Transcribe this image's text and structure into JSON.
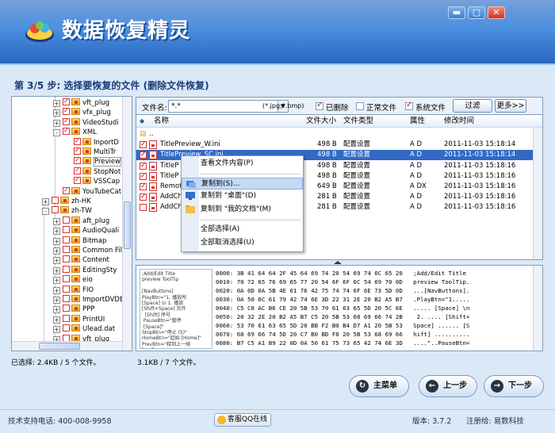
{
  "app": {
    "title": "数据恢复精灵"
  },
  "window_controls": {
    "minimize": "▬",
    "maximize": "▢",
    "close": "✕"
  },
  "step": {
    "title": "第 3/5 步: 选择要恢复的文件 (删除文件恢复)"
  },
  "tree": {
    "items": [
      {
        "label": "vft_plug",
        "level": 3,
        "checked": true,
        "exp": "+"
      },
      {
        "label": "vfx_plug",
        "level": 3,
        "checked": true,
        "exp": "+"
      },
      {
        "label": "VideoStudi",
        "level": 3,
        "checked": true,
        "exp": "+"
      },
      {
        "label": "XML",
        "level": 3,
        "checked": true,
        "exp": "-"
      },
      {
        "label": "InportD",
        "level": 4,
        "checked": true,
        "exp": ""
      },
      {
        "label": "MultiTr",
        "level": 4,
        "checked": true,
        "exp": ""
      },
      {
        "label": "Preview",
        "level": 4,
        "checked": true,
        "exp": ""
      },
      {
        "label": "StopNot",
        "level": 4,
        "checked": true,
        "exp": ""
      },
      {
        "label": "VSSCap",
        "level": 4,
        "checked": true,
        "exp": ""
      },
      {
        "label": "YouTubeCat",
        "level": 3,
        "checked": true,
        "exp": ""
      },
      {
        "label": "zh-HK",
        "level": 2,
        "checked": false,
        "exp": "+"
      },
      {
        "label": "zh-TW",
        "level": 2,
        "checked": false,
        "exp": "-"
      },
      {
        "label": "aft_plug",
        "level": 3,
        "checked": false,
        "exp": "+"
      },
      {
        "label": "AudioQuali",
        "level": 3,
        "checked": false,
        "exp": "+"
      },
      {
        "label": "Bitmap",
        "level": 3,
        "checked": false,
        "exp": "+"
      },
      {
        "label": "Common Fil",
        "level": 3,
        "checked": false,
        "exp": "+"
      },
      {
        "label": "Content",
        "level": 3,
        "checked": false,
        "exp": "+"
      },
      {
        "label": "EditingSty",
        "level": 3,
        "checked": false,
        "exp": "+"
      },
      {
        "label": "eio",
        "level": 3,
        "checked": false,
        "exp": "+"
      },
      {
        "label": "FIO",
        "level": 3,
        "checked": false,
        "exp": "+"
      },
      {
        "label": "ImportDVDE",
        "level": 3,
        "checked": false,
        "exp": "+"
      },
      {
        "label": "PPP",
        "level": 3,
        "checked": false,
        "exp": "+"
      },
      {
        "label": "PrintUI",
        "level": 3,
        "checked": false,
        "exp": "+"
      },
      {
        "label": "Ulead.dat",
        "level": 3,
        "checked": false,
        "exp": "+"
      },
      {
        "label": "vft_plug",
        "level": 3,
        "checked": false,
        "exp": "+"
      }
    ]
  },
  "filter": {
    "filename_label": "文件名:",
    "filename_value": "*.*",
    "ext_hint": "(*.jpg;*.bmp)",
    "deleted_label": "已删除",
    "normal_label": "正常文件",
    "system_label": "系统文件",
    "filter_button": "过滤",
    "more_button": "更多>>"
  },
  "list": {
    "headers": {
      "name": "名称",
      "size": "文件大小",
      "type": "文件类型",
      "attr": "属性",
      "mtime": "修改时间"
    },
    "rows": [
      {
        "name": "..",
        "size": "",
        "type": "",
        "attr": "",
        "mtime": "",
        "checked": false
      },
      {
        "name": "TitlePreview_W.ini",
        "size": "498 B",
        "type": "配置设置",
        "attr": "A D",
        "mtime": "2011-11-03 15:18:14",
        "checked": true
      },
      {
        "name": "TitlePreview_SC.ini",
        "size": "498 B",
        "type": "配置设置",
        "attr": "A D",
        "mtime": "2011-11-03 15:18:14",
        "checked": true
      },
      {
        "name": "TitleP",
        "size": "498 B",
        "type": "配置设置",
        "attr": "A D",
        "mtime": "2011-11-03 15:18:16",
        "checked": true
      },
      {
        "name": "TitleP",
        "size": "498 B",
        "type": "配置设置",
        "attr": "A D",
        "mtime": "2011-11-03 15:18:16",
        "checked": true
      },
      {
        "name": "RemotC",
        "size": "649 B",
        "type": "配置设置",
        "attr": "A DX",
        "mtime": "2011-11-03 15:18:16",
        "checked": true
      },
      {
        "name": "AddCh",
        "size": "281 B",
        "type": "配置设置",
        "attr": "A D",
        "mtime": "2011-11-03 15:18:16",
        "checked": true
      },
      {
        "name": "AddCh",
        "size": "281 B",
        "type": "配置设置",
        "attr": "A D",
        "mtime": "2011-11-03 15:18:16",
        "checked": false
      }
    ]
  },
  "context_menu": {
    "view": "查看文件内容(P)",
    "copy_to": "复制到(S)...",
    "copy_desktop": "复制到 \"桌面\"(D)",
    "copy_docs": "复制到 \"我的文档\"(M)",
    "select_all": "全部选择(A)",
    "deselect_all": "全部取消选择(U)"
  },
  "preview": {
    "text": ";Add/Edit Title\npreview ToolTip\n\n[NavButtons]\nPlayBtn=\"1. 播放所\n[Space] \\n 1. 播放\n[Shift+Space] 另外\n  [Shift] 序号\n PauseBtn=\"暂停\n [Space]\"\nStopBtn=\"停止 (S)\"\nHomeBtn=\"起始 [Home]\"\nPrevBtn=\"释到上一帧\n[<--]\"",
    "hex": [
      "0000: 3B 41 64 64 2F 45 64 69 74 20 54 69 74 6C 65 20   ;Add/Edit Title",
      "0010: 70 72 65 76 69 65 77 20 54 6F 6F 6C 54 69 70 0D   preview ToolTip.",
      "0020: 0A 0D 0A 5B 4E 61 76 42 75 74 74 6F 6E 73 5D 0D   ...[NavButtons].",
      "0030: 0A 50 6C 61 79 42 74 6E 3D 22 31 2E 20 B2 A5 B7   .PlayBtn=\"1.....",
      "0040: C5 C8 AC B6 CE 20 5B 53 70 61 63 65 5D 20 5C 6E   ..... [Space] \\n",
      "0050: 20 32 2E 20 B2 A5 B7 C5 20 5B 53 68 69 66 74 2B    2. .... [Shift+",
      "0060: 53 70 61 63 65 5D 20 BB F2 B0 B4 D7 A1 20 5B 53   Space] ...... [S",
      "0070: 68 69 66 74 5D 20 C7 B0 BD F8 20 5B 53 68 69 66   hift] ..........",
      "0080: B7 C5 A1 B9 22 0D 0A 50 61 75 73 65 42 74 6E 3D   ....\"..PauseBtn="
    ]
  },
  "status": {
    "left": "已选择: 2.4KB / 5 个文件。",
    "right": "3.1KB / 7 个文件。"
  },
  "nav": {
    "main_menu": "主菜单",
    "prev": "上一步",
    "next": "下一步"
  },
  "footer": {
    "support": "技术支持电话: 400-008-9958",
    "qq": "客服QQ在线",
    "version": "版本: 3.7.2",
    "registered": "注册给: 易数科技"
  },
  "colors": {
    "accent": "#316ac5",
    "header": "#2d6fc7",
    "background": "#dbe8f7"
  }
}
